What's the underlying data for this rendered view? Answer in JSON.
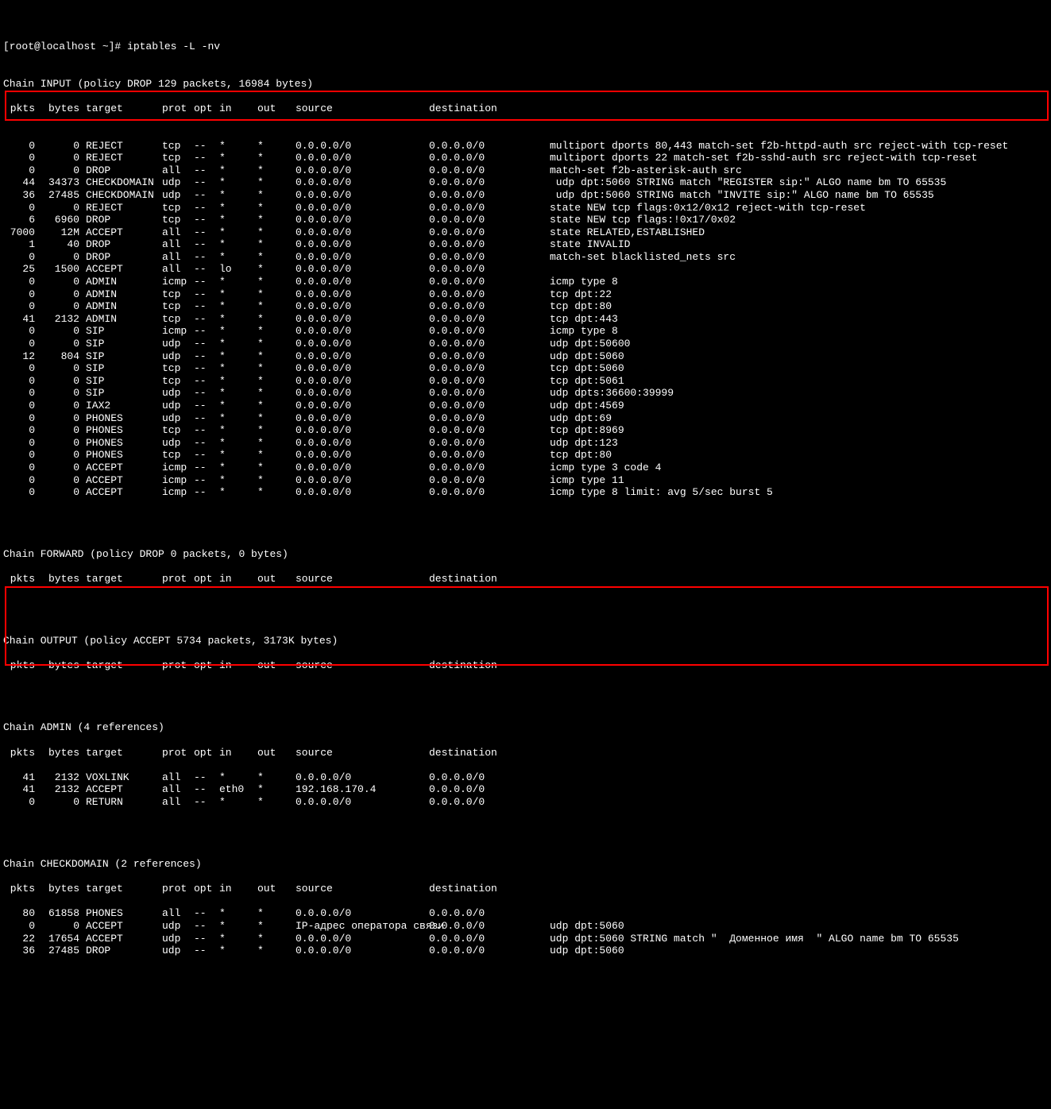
{
  "prompt": "[root@localhost ~]# ",
  "command": "iptables -L -nv",
  "cols": {
    "pkts": " pkts",
    "bytes": "bytes",
    "target": "target",
    "prot": "prot",
    "opt": "opt",
    "in": "in",
    "out": "out",
    "source": "source",
    "destination": "destination"
  },
  "chains": {
    "input": {
      "header": "Chain INPUT (policy DROP 129 packets, 16984 bytes)",
      "rules": [
        {
          "pkts": "0",
          "bytes": "0",
          "target": "REJECT",
          "prot": "tcp",
          "opt": "--",
          "in": "*",
          "out": "*",
          "src": "0.0.0.0/0",
          "dst": "0.0.0.0/0",
          "ext": "multiport dports 80,443 match-set f2b-httpd-auth src reject-with tcp-reset"
        },
        {
          "pkts": "0",
          "bytes": "0",
          "target": "REJECT",
          "prot": "tcp",
          "opt": "--",
          "in": "*",
          "out": "*",
          "src": "0.0.0.0/0",
          "dst": "0.0.0.0/0",
          "ext": "multiport dports 22 match-set f2b-sshd-auth src reject-with tcp-reset"
        },
        {
          "pkts": "0",
          "bytes": "0",
          "target": "DROP",
          "prot": "all",
          "opt": "--",
          "in": "*",
          "out": "*",
          "src": "0.0.0.0/0",
          "dst": "0.0.0.0/0",
          "ext": "match-set f2b-asterisk-auth src"
        },
        {
          "pkts": "44",
          "bytes": "34373",
          "target": "CHECKDOMAIN",
          "prot": "udp",
          "opt": "--",
          "in": "*",
          "out": "*",
          "src": "0.0.0.0/0",
          "dst": "0.0.0.0/0",
          "ext": " udp dpt:5060 STRING match \"REGISTER sip:\" ALGO name bm TO 65535"
        },
        {
          "pkts": "36",
          "bytes": "27485",
          "target": "CHECKDOMAIN",
          "prot": "udp",
          "opt": "--",
          "in": "*",
          "out": "*",
          "src": "0.0.0.0/0",
          "dst": "0.0.0.0/0",
          "ext": " udp dpt:5060 STRING match \"INVITE sip:\" ALGO name bm TO 65535"
        },
        {
          "pkts": "0",
          "bytes": "0",
          "target": "REJECT",
          "prot": "tcp",
          "opt": "--",
          "in": "*",
          "out": "*",
          "src": "0.0.0.0/0",
          "dst": "0.0.0.0/0",
          "ext": "state NEW tcp flags:0x12/0x12 reject-with tcp-reset"
        },
        {
          "pkts": "6",
          "bytes": "6960",
          "target": "DROP",
          "prot": "tcp",
          "opt": "--",
          "in": "*",
          "out": "*",
          "src": "0.0.0.0/0",
          "dst": "0.0.0.0/0",
          "ext": "state NEW tcp flags:!0x17/0x02"
        },
        {
          "pkts": "7000",
          "bytes": "12M",
          "target": "ACCEPT",
          "prot": "all",
          "opt": "--",
          "in": "*",
          "out": "*",
          "src": "0.0.0.0/0",
          "dst": "0.0.0.0/0",
          "ext": "state RELATED,ESTABLISHED"
        },
        {
          "pkts": "1",
          "bytes": "40",
          "target": "DROP",
          "prot": "all",
          "opt": "--",
          "in": "*",
          "out": "*",
          "src": "0.0.0.0/0",
          "dst": "0.0.0.0/0",
          "ext": "state INVALID"
        },
        {
          "pkts": "0",
          "bytes": "0",
          "target": "DROP",
          "prot": "all",
          "opt": "--",
          "in": "*",
          "out": "*",
          "src": "0.0.0.0/0",
          "dst": "0.0.0.0/0",
          "ext": "match-set blacklisted_nets src"
        },
        {
          "pkts": "25",
          "bytes": "1500",
          "target": "ACCEPT",
          "prot": "all",
          "opt": "--",
          "in": "lo",
          "out": "*",
          "src": "0.0.0.0/0",
          "dst": "0.0.0.0/0",
          "ext": ""
        },
        {
          "pkts": "0",
          "bytes": "0",
          "target": "ADMIN",
          "prot": "icmp",
          "opt": "--",
          "in": "*",
          "out": "*",
          "src": "0.0.0.0/0",
          "dst": "0.0.0.0/0",
          "ext": "icmp type 8"
        },
        {
          "pkts": "0",
          "bytes": "0",
          "target": "ADMIN",
          "prot": "tcp",
          "opt": "--",
          "in": "*",
          "out": "*",
          "src": "0.0.0.0/0",
          "dst": "0.0.0.0/0",
          "ext": "tcp dpt:22"
        },
        {
          "pkts": "0",
          "bytes": "0",
          "target": "ADMIN",
          "prot": "tcp",
          "opt": "--",
          "in": "*",
          "out": "*",
          "src": "0.0.0.0/0",
          "dst": "0.0.0.0/0",
          "ext": "tcp dpt:80"
        },
        {
          "pkts": "41",
          "bytes": "2132",
          "target": "ADMIN",
          "prot": "tcp",
          "opt": "--",
          "in": "*",
          "out": "*",
          "src": "0.0.0.0/0",
          "dst": "0.0.0.0/0",
          "ext": "tcp dpt:443"
        },
        {
          "pkts": "0",
          "bytes": "0",
          "target": "SIP",
          "prot": "icmp",
          "opt": "--",
          "in": "*",
          "out": "*",
          "src": "0.0.0.0/0",
          "dst": "0.0.0.0/0",
          "ext": "icmp type 8"
        },
        {
          "pkts": "0",
          "bytes": "0",
          "target": "SIP",
          "prot": "udp",
          "opt": "--",
          "in": "*",
          "out": "*",
          "src": "0.0.0.0/0",
          "dst": "0.0.0.0/0",
          "ext": "udp dpt:50600"
        },
        {
          "pkts": "12",
          "bytes": "804",
          "target": "SIP",
          "prot": "udp",
          "opt": "--",
          "in": "*",
          "out": "*",
          "src": "0.0.0.0/0",
          "dst": "0.0.0.0/0",
          "ext": "udp dpt:5060"
        },
        {
          "pkts": "0",
          "bytes": "0",
          "target": "SIP",
          "prot": "tcp",
          "opt": "--",
          "in": "*",
          "out": "*",
          "src": "0.0.0.0/0",
          "dst": "0.0.0.0/0",
          "ext": "tcp dpt:5060"
        },
        {
          "pkts": "0",
          "bytes": "0",
          "target": "SIP",
          "prot": "tcp",
          "opt": "--",
          "in": "*",
          "out": "*",
          "src": "0.0.0.0/0",
          "dst": "0.0.0.0/0",
          "ext": "tcp dpt:5061"
        },
        {
          "pkts": "0",
          "bytes": "0",
          "target": "SIP",
          "prot": "udp",
          "opt": "--",
          "in": "*",
          "out": "*",
          "src": "0.0.0.0/0",
          "dst": "0.0.0.0/0",
          "ext": "udp dpts:36600:39999"
        },
        {
          "pkts": "0",
          "bytes": "0",
          "target": "IAX2",
          "prot": "udp",
          "opt": "--",
          "in": "*",
          "out": "*",
          "src": "0.0.0.0/0",
          "dst": "0.0.0.0/0",
          "ext": "udp dpt:4569"
        },
        {
          "pkts": "0",
          "bytes": "0",
          "target": "PHONES",
          "prot": "udp",
          "opt": "--",
          "in": "*",
          "out": "*",
          "src": "0.0.0.0/0",
          "dst": "0.0.0.0/0",
          "ext": "udp dpt:69"
        },
        {
          "pkts": "0",
          "bytes": "0",
          "target": "PHONES",
          "prot": "tcp",
          "opt": "--",
          "in": "*",
          "out": "*",
          "src": "0.0.0.0/0",
          "dst": "0.0.0.0/0",
          "ext": "tcp dpt:8969"
        },
        {
          "pkts": "0",
          "bytes": "0",
          "target": "PHONES",
          "prot": "udp",
          "opt": "--",
          "in": "*",
          "out": "*",
          "src": "0.0.0.0/0",
          "dst": "0.0.0.0/0",
          "ext": "udp dpt:123"
        },
        {
          "pkts": "0",
          "bytes": "0",
          "target": "PHONES",
          "prot": "tcp",
          "opt": "--",
          "in": "*",
          "out": "*",
          "src": "0.0.0.0/0",
          "dst": "0.0.0.0/0",
          "ext": "tcp dpt:80"
        },
        {
          "pkts": "0",
          "bytes": "0",
          "target": "ACCEPT",
          "prot": "icmp",
          "opt": "--",
          "in": "*",
          "out": "*",
          "src": "0.0.0.0/0",
          "dst": "0.0.0.0/0",
          "ext": "icmp type 3 code 4"
        },
        {
          "pkts": "0",
          "bytes": "0",
          "target": "ACCEPT",
          "prot": "icmp",
          "opt": "--",
          "in": "*",
          "out": "*",
          "src": "0.0.0.0/0",
          "dst": "0.0.0.0/0",
          "ext": "icmp type 11"
        },
        {
          "pkts": "0",
          "bytes": "0",
          "target": "ACCEPT",
          "prot": "icmp",
          "opt": "--",
          "in": "*",
          "out": "*",
          "src": "0.0.0.0/0",
          "dst": "0.0.0.0/0",
          "ext": "icmp type 8 limit: avg 5/sec burst 5"
        }
      ]
    },
    "forward": {
      "header": "Chain FORWARD (policy DROP 0 packets, 0 bytes)"
    },
    "output": {
      "header": "Chain OUTPUT (policy ACCEPT 5734 packets, 3173K bytes)"
    },
    "admin": {
      "header": "Chain ADMIN (4 references)",
      "rules": [
        {
          "pkts": "41",
          "bytes": "2132",
          "target": "VOXLINK",
          "prot": "all",
          "opt": "--",
          "in": "*",
          "out": "*",
          "src": "0.0.0.0/0",
          "dst": "0.0.0.0/0",
          "ext": ""
        },
        {
          "pkts": "41",
          "bytes": "2132",
          "target": "ACCEPT",
          "prot": "all",
          "opt": "--",
          "in": "eth0",
          "out": "*",
          "src": "192.168.170.4",
          "dst": "0.0.0.0/0",
          "ext": ""
        },
        {
          "pkts": "0",
          "bytes": "0",
          "target": "RETURN",
          "prot": "all",
          "opt": "--",
          "in": "*",
          "out": "*",
          "src": "0.0.0.0/0",
          "dst": "0.0.0.0/0",
          "ext": ""
        }
      ]
    },
    "checkdomain": {
      "header": "Chain CHECKDOMAIN (2 references)",
      "rules": [
        {
          "pkts": "80",
          "bytes": "61858",
          "target": "PHONES",
          "prot": "all",
          "opt": "--",
          "in": "*",
          "out": "*",
          "src": "0.0.0.0/0",
          "dst": "0.0.0.0/0",
          "ext": ""
        },
        {
          "pkts": "0",
          "bytes": "0",
          "target": "ACCEPT",
          "prot": "udp",
          "opt": "--",
          "in": "*",
          "out": "*",
          "src": "IP-адрес оператора связи",
          "dst": "0.0.0.0/0",
          "ext": "udp dpt:5060"
        },
        {
          "pkts": "22",
          "bytes": "17654",
          "target": "ACCEPT",
          "prot": "udp",
          "opt": "--",
          "in": "*",
          "out": "*",
          "src": "0.0.0.0/0",
          "dst": "0.0.0.0/0",
          "ext": "udp dpt:5060 STRING match \"  Доменное имя  \" ALGO name bm TO 65535"
        },
        {
          "pkts": "36",
          "bytes": "27485",
          "target": "DROP",
          "prot": "udp",
          "opt": "--",
          "in": "*",
          "out": "*",
          "src": "0.0.0.0/0",
          "dst": "0.0.0.0/0",
          "ext": "udp dpt:5060"
        }
      ]
    }
  }
}
